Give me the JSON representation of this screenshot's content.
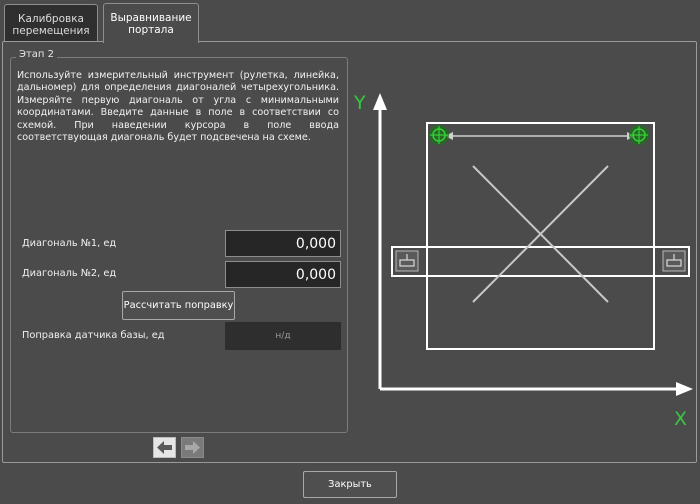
{
  "tabs": [
    {
      "label_line1": "Калибровка",
      "label_line2": "перемещения",
      "active": false
    },
    {
      "label_line1": "Выравнивание",
      "label_line2": "портала",
      "active": true
    }
  ],
  "step": {
    "legend": "Этап 2",
    "instructions": "Используйте измерительный инструмент (рулетка, линейка, дальномер) для определения диагоналей четырехугольника. Измеряйте первую диагональ от угла с минимальными координатами. Введите данные в поле в соответствии со схемой. При наведении курсора в поле ввода соответствующая диагональ будет подсвечена на схеме."
  },
  "fields": {
    "diagonal1_label": "Диагональ №1, ед",
    "diagonal1_value": "0,000",
    "diagonal2_label": "Диагональ №2, ед",
    "diagonal2_value": "0,000",
    "calc_button": "Рассчитать поправку",
    "correction_label": "Поправка датчика базы, ед",
    "correction_value": "н/д"
  },
  "diagram": {
    "y_axis_label": "Y",
    "x_axis_label": "X",
    "axis_label_color": "#35c93f",
    "marker_color": "#32c832"
  },
  "navigation": {
    "prev_icon": "arrow-left-icon",
    "next_icon": "arrow-right-icon"
  },
  "footer": {
    "close_button": "Закрыть"
  }
}
